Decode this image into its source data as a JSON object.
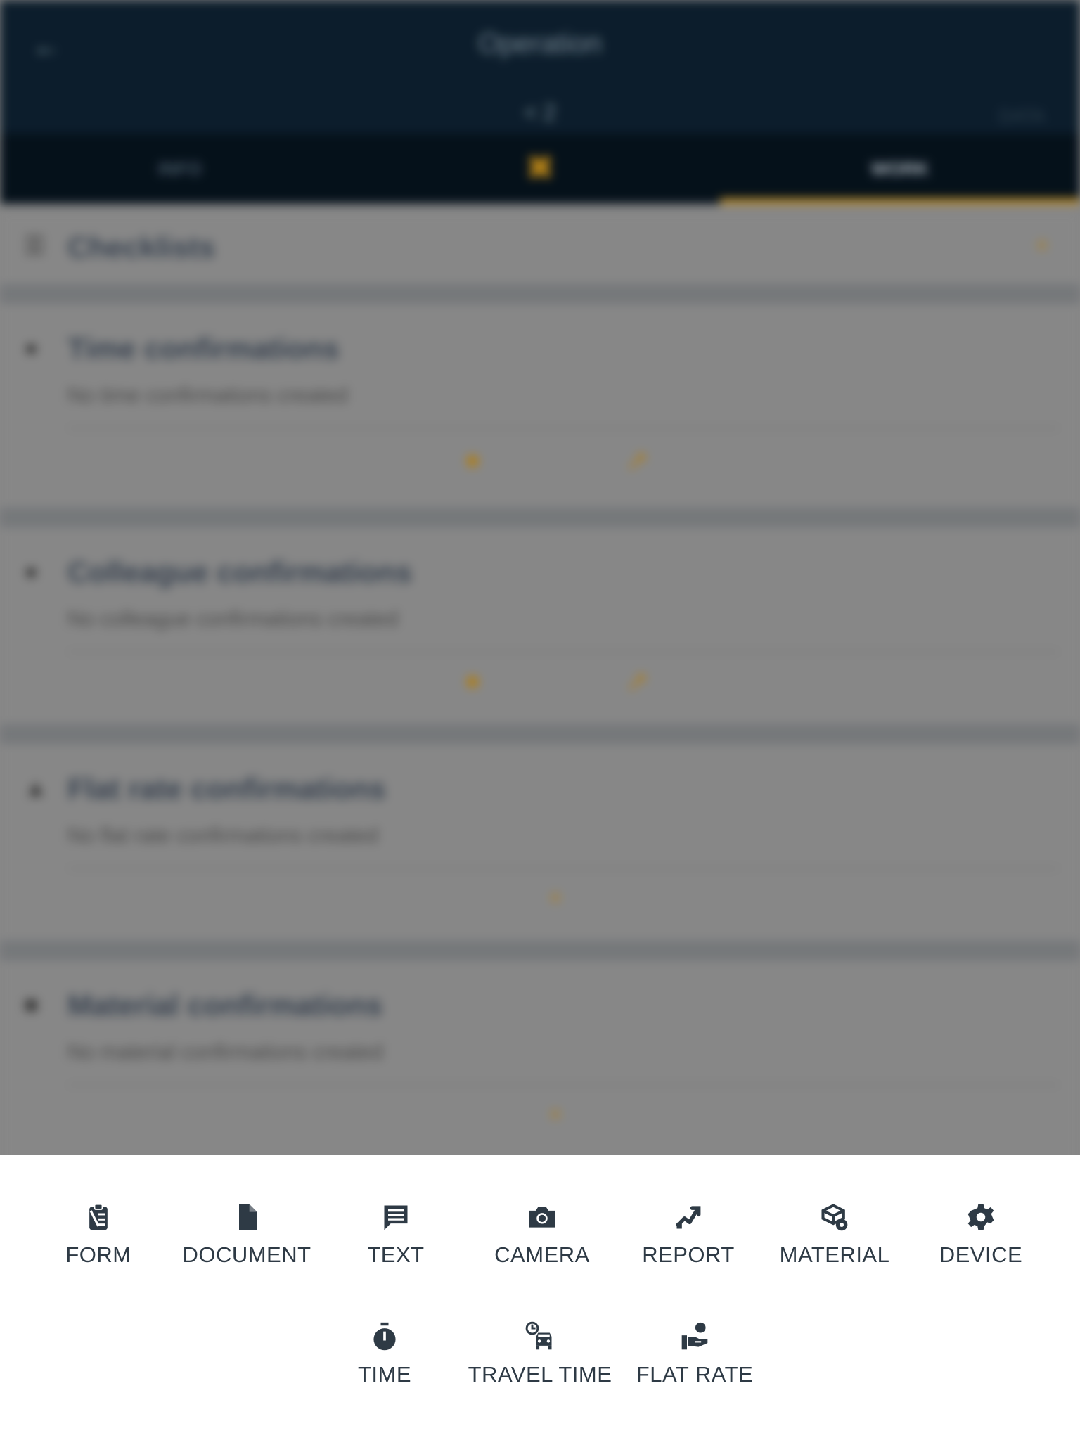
{
  "header": {
    "back_icon": "arrow-back-icon",
    "title": "Operation",
    "subtitle": "< 2",
    "right_text": "DATA"
  },
  "tabs": [
    {
      "label": "INFO"
    },
    {
      "label": "",
      "icon": "logo-x-icon"
    },
    {
      "label": "WORK",
      "active": true
    }
  ],
  "sections": [
    {
      "title": "Checklists",
      "icon": "checklist-icon",
      "description": ""
    },
    {
      "title": "Time confirmations",
      "icon": "lock-icon",
      "description": "No time confirmations created"
    },
    {
      "title": "Colleague confirmations",
      "icon": "lock-icon",
      "description": "No colleague confirmations created"
    },
    {
      "title": "Flat rate confirmations",
      "icon": "flat-rate-icon",
      "description": "No flat rate confirmations created"
    },
    {
      "title": "Material confirmations",
      "icon": "material-icon",
      "description": "No material confirmations created"
    }
  ],
  "sheet": {
    "row1": [
      {
        "label": "FORM",
        "icon": "form-icon"
      },
      {
        "label": "DOCUMENT",
        "icon": "document-icon"
      },
      {
        "label": "TEXT",
        "icon": "text-icon"
      },
      {
        "label": "CAMERA",
        "icon": "camera-icon"
      },
      {
        "label": "REPORT",
        "icon": "report-icon"
      },
      {
        "label": "MATERIAL",
        "icon": "material-icon"
      },
      {
        "label": "DEVICE",
        "icon": "gear-icon"
      }
    ],
    "row2": [
      {
        "label": "TIME",
        "icon": "stopwatch-icon"
      },
      {
        "label": "TRAVEL TIME",
        "icon": "travel-time-icon"
      },
      {
        "label": "FLAT RATE",
        "icon": "flat-rate-icon"
      }
    ]
  },
  "colors": {
    "header_bg": "#0d1f2e",
    "accent": "#c99424",
    "icon": "#2e3a45"
  }
}
